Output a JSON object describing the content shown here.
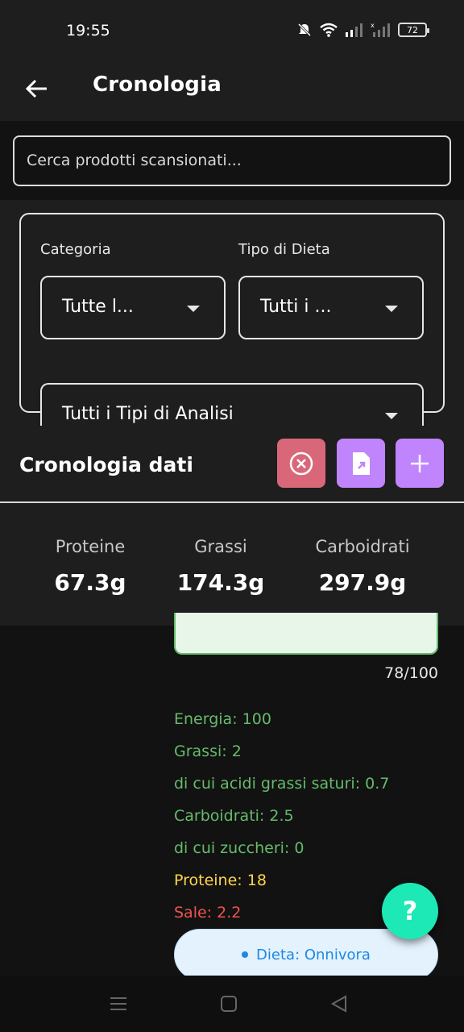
{
  "status_bar": {
    "time": "19:55",
    "battery": "72"
  },
  "app_bar": {
    "title": "Cronologia"
  },
  "search": {
    "placeholder": "Cerca prodotti scansionati..."
  },
  "filters": {
    "category_label": "Categoria",
    "category_value": "Tutte l...",
    "diet_label": "Tipo di Dieta",
    "diet_value": "Tutti i ...",
    "analysis_value": "Tutti i Tipi di Analisi"
  },
  "history": {
    "title": "Cronologia dati",
    "actions": [
      "clear-icon",
      "export-icon",
      "add-icon"
    ],
    "stats": [
      {
        "label": "Proteine",
        "value": "67.3g"
      },
      {
        "label": "Grassi",
        "value": "174.3g"
      },
      {
        "label": "Carboidrati",
        "value": "297.9g"
      }
    ]
  },
  "item": {
    "score": "78/100",
    "nutrients": [
      {
        "text": "Energia: 100",
        "color": "#66bb6a"
      },
      {
        "text": "Grassi: 2",
        "color": "#66bb6a"
      },
      {
        "text": "di cui acidi grassi saturi: 0.7",
        "color": "#66bb6a"
      },
      {
        "text": "Carboidrati: 2.5",
        "color": "#66bb6a"
      },
      {
        "text": "di cui zuccheri: 0",
        "color": "#66bb6a"
      },
      {
        "text": "Proteine: 18",
        "color": "#ffd54f"
      },
      {
        "text": "Sale: 2.2",
        "color": "#ef5350"
      }
    ],
    "diet_chip": "Dieta: Onnivora"
  },
  "fab": {
    "label": "?"
  },
  "colors": {
    "accent_purple": "#c084fc",
    "danger_pink": "#d9677a",
    "fab_teal": "#1de9b6"
  }
}
